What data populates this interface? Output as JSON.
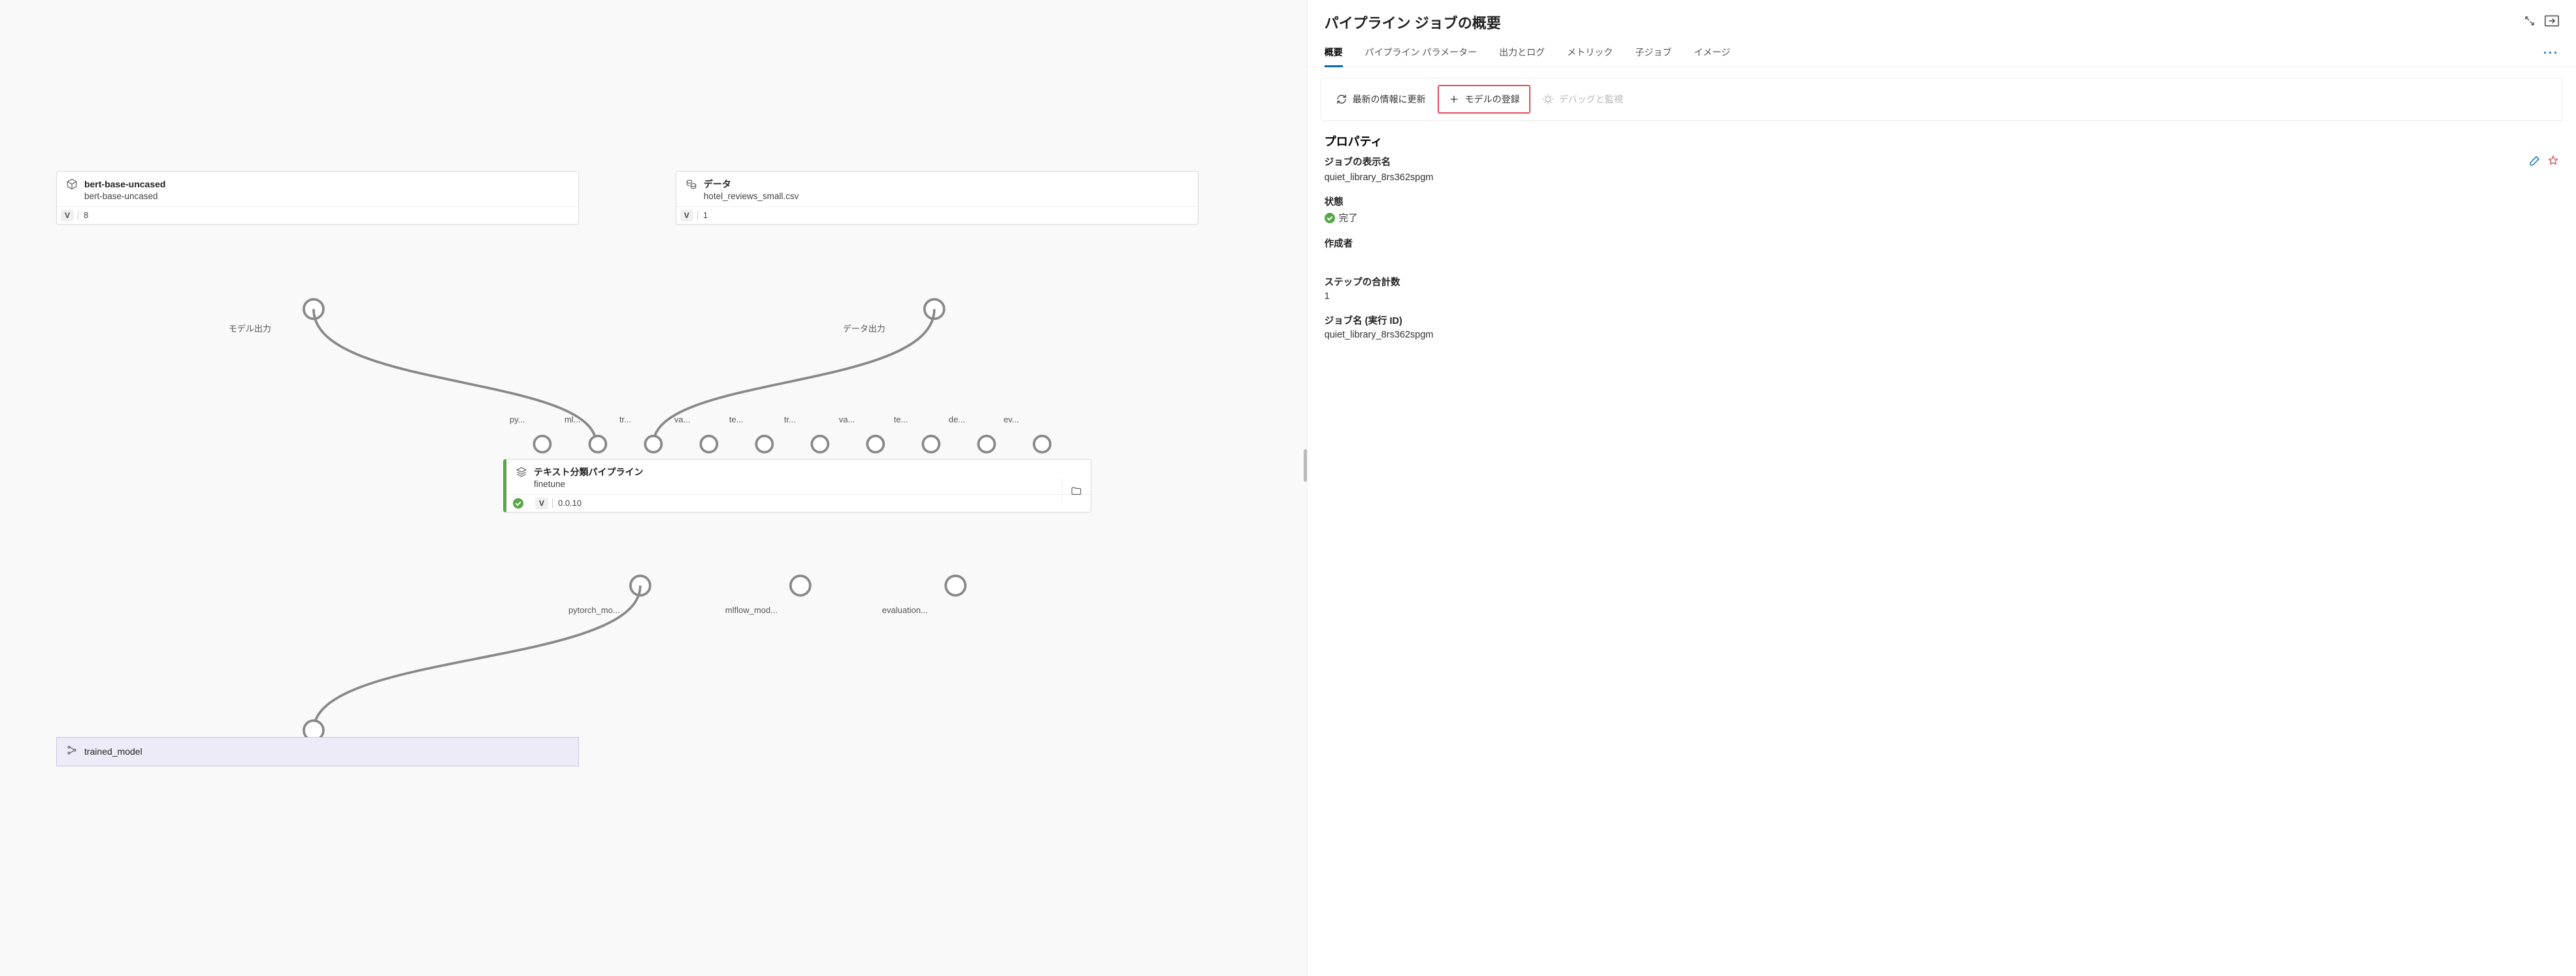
{
  "canvas": {
    "node_bert": {
      "title": "bert-base-uncased",
      "subtitle": "bert-base-uncased",
      "v": "V",
      "ver": "8",
      "out_label": "モデル出力"
    },
    "node_data": {
      "title": "データ",
      "subtitle": "hotel_reviews_small.csv",
      "v": "V",
      "ver": "1",
      "out_label": "データ出力"
    },
    "node_child": {
      "title": "テキスト分類パイプライン",
      "subtitle": "finetune",
      "v": "V",
      "ver": "0.0.10"
    },
    "child_in_labels": [
      "py...",
      "ml...",
      "tr...",
      "va...",
      "te...",
      "tr...",
      "va...",
      "te...",
      "de...",
      "ev..."
    ],
    "child_out_labels": [
      "pytorch_mo...",
      "mlflow_mod...",
      "evaluation..."
    ],
    "node_out": {
      "title": "trained_model"
    }
  },
  "panel": {
    "title": "パイプライン ジョブの概要",
    "tabs": [
      "概要",
      "パイプライン パラメーター",
      "出力とログ",
      "メトリック",
      "子ジョブ",
      "イメージ"
    ],
    "toolbar": {
      "refresh": "最新の情報に更新",
      "register": "モデルの登録",
      "debug": "デバッグと監視"
    },
    "section": "プロパティ",
    "props": {
      "display_name_label": "ジョブの表示名",
      "display_name_value": "quiet_library_8rs362spgm",
      "status_label": "状態",
      "status_value": "完了",
      "creator_label": "作成者",
      "steps_label": "ステップの合計数",
      "steps_value": "1",
      "jobid_label": "ジョブ名 (実行 ID)",
      "jobid_value": "quiet_library_8rs362spgm"
    }
  }
}
